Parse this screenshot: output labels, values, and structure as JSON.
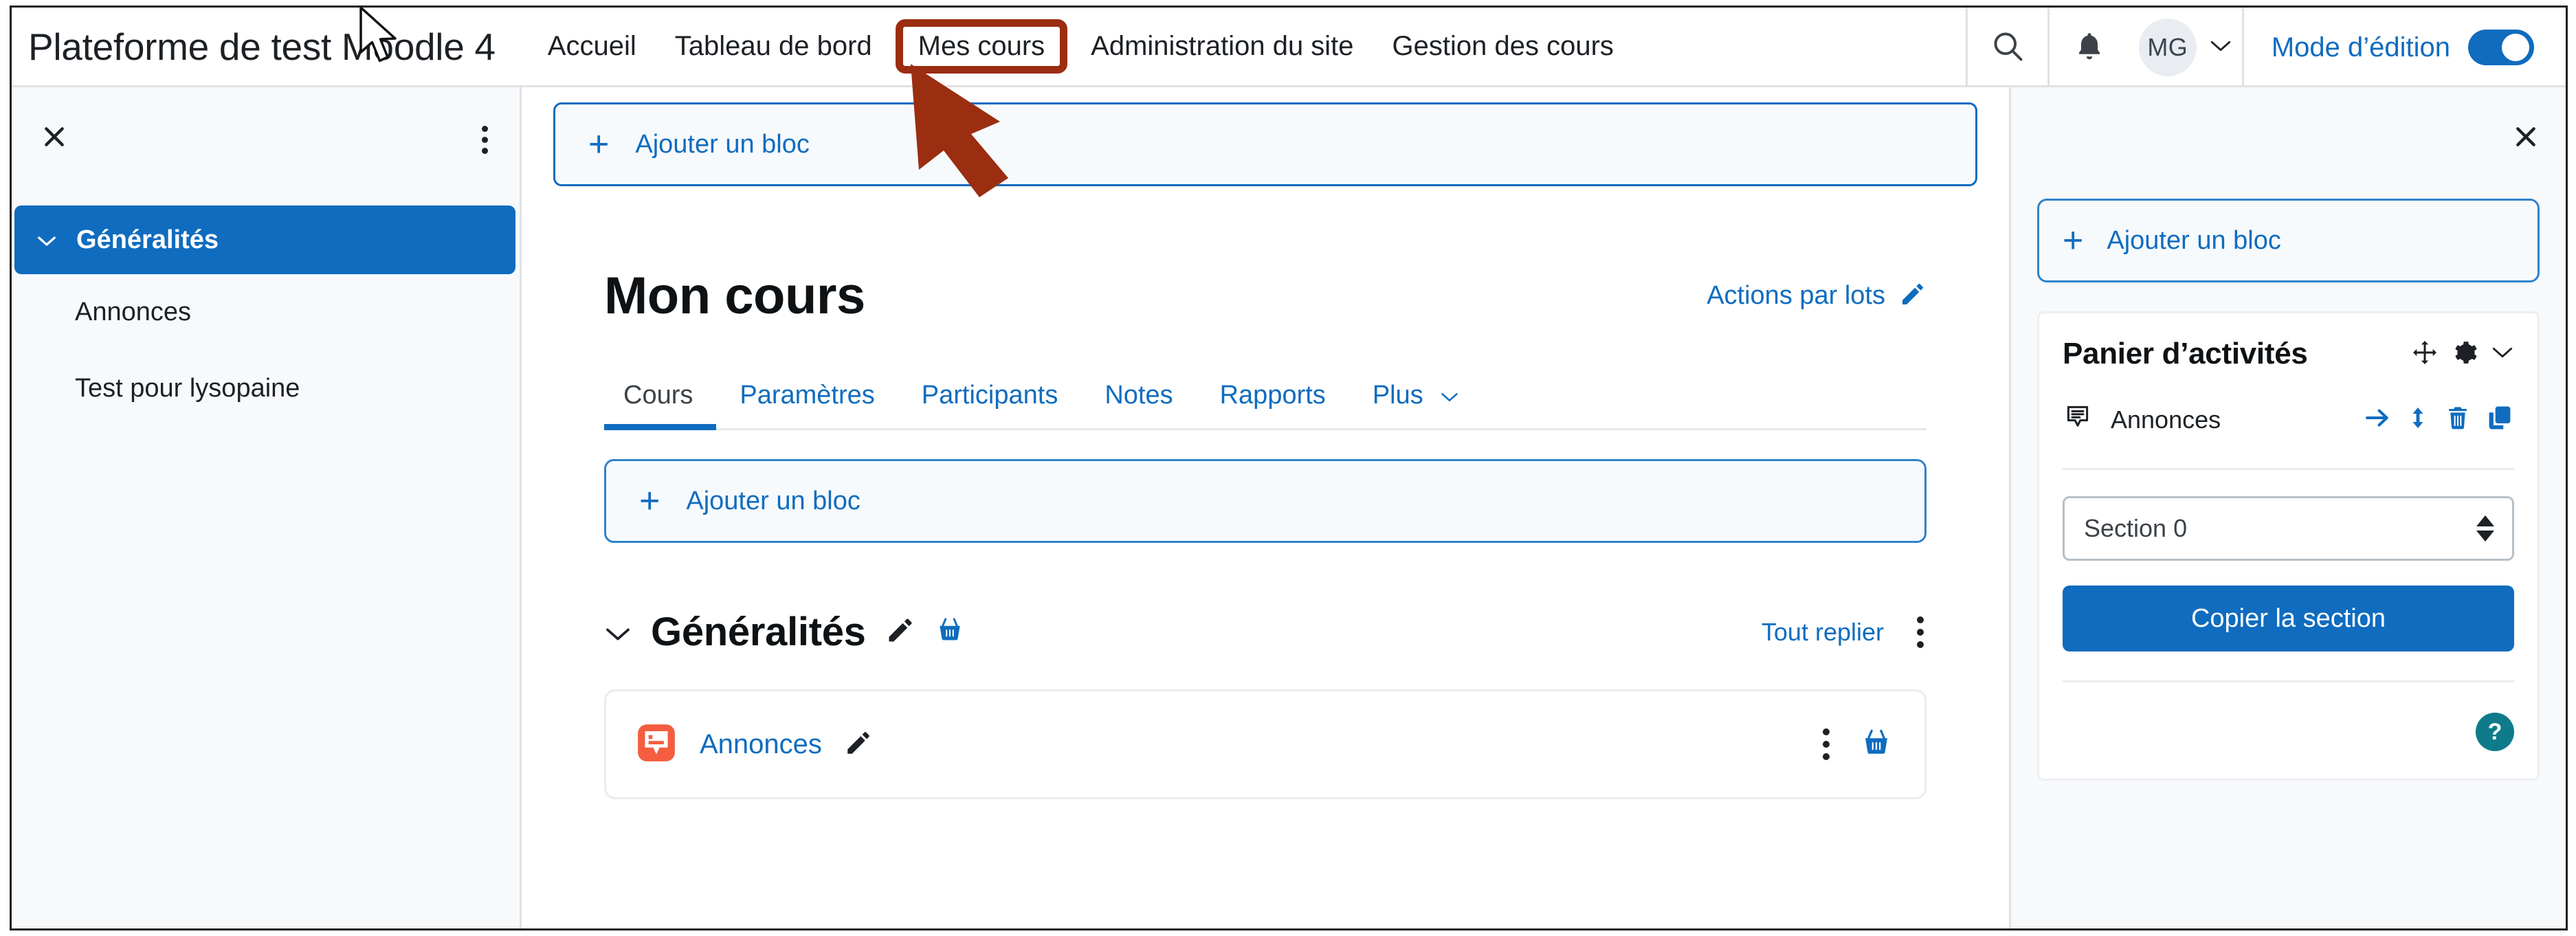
{
  "header": {
    "brand": "Plateforme de test Moodle 4",
    "nav_items": [
      {
        "label": "Accueil",
        "highlighted": false
      },
      {
        "label": "Tableau de bord",
        "highlighted": false
      },
      {
        "label": "Mes cours",
        "highlighted": true
      },
      {
        "label": "Administration du site",
        "highlighted": false
      },
      {
        "label": "Gestion des cours",
        "highlighted": false
      }
    ],
    "search_icon": "search-icon",
    "notification_icon": "bell-icon",
    "avatar_initials": "MG",
    "avatar_caret": "⌄",
    "edit_mode_label": "Mode d’édition",
    "edit_mode_on": true,
    "accent_color": "#0f6cbf",
    "highlight_color": "#9b2d11"
  },
  "course_index": {
    "close_icon": "close-icon",
    "menu_icon": "kebab-menu-icon",
    "section": {
      "label": "Généralités",
      "chevron": "⌄",
      "selected": true
    },
    "items": [
      {
        "label": "Annonces"
      },
      {
        "label": "Test pour lysopaine"
      }
    ]
  },
  "main": {
    "add_block_top_label": "Ajouter un bloc",
    "add_block_top_icon": "plus-icon",
    "course_title": "Mon cours",
    "bulk_actions_label": "Actions par lots",
    "bulk_actions_icon": "pencil-icon",
    "tabs": [
      {
        "label": "Cours",
        "active": true
      },
      {
        "label": "Paramètres",
        "active": false
      },
      {
        "label": "Participants",
        "active": false
      },
      {
        "label": "Notes",
        "active": false
      },
      {
        "label": "Rapports",
        "active": false
      },
      {
        "label": "Plus",
        "active": false,
        "caret": "⌄"
      }
    ],
    "add_block_inner_label": "Ajouter un bloc",
    "add_block_inner_icon": "plus-icon",
    "section": {
      "chevron": "⌄",
      "title": "Généralités",
      "edit_icon": "pencil-icon",
      "basket_icon": "activity-basket-icon",
      "collapse_all_label": "Tout replier",
      "menu_icon": "kebab-menu-icon"
    },
    "activities": [
      {
        "icon": "forum-icon",
        "icon_color": "#f45d3f",
        "name": "Annonces",
        "edit_icon": "pencil-icon",
        "menu_icon": "kebab-menu-icon",
        "basket_icon": "activity-basket-icon"
      }
    ]
  },
  "drawer": {
    "close_icon": "close-icon",
    "add_block_label": "Ajouter un bloc",
    "add_block_icon": "plus-icon",
    "card": {
      "title": "Panier d’activités",
      "move_icon": "move-arrows-icon",
      "settings_icon": "gear-icon",
      "collapse_icon": "chevron-down-icon",
      "item": {
        "icon": "forum-outline-icon",
        "label": "Annonces",
        "actions": [
          {
            "icon": "arrow-right-icon"
          },
          {
            "icon": "arrows-up-down-icon"
          },
          {
            "icon": "trash-icon"
          },
          {
            "icon": "copy-icon"
          }
        ]
      },
      "select_value": "Section 0",
      "copy_button_label": "Copier la section",
      "help_icon": "question-mark-icon",
      "help_color": "#0f7b8a"
    }
  },
  "annotation": {
    "arrow_color": "#9b2d11",
    "arrow_points_to": "Mes cours"
  }
}
